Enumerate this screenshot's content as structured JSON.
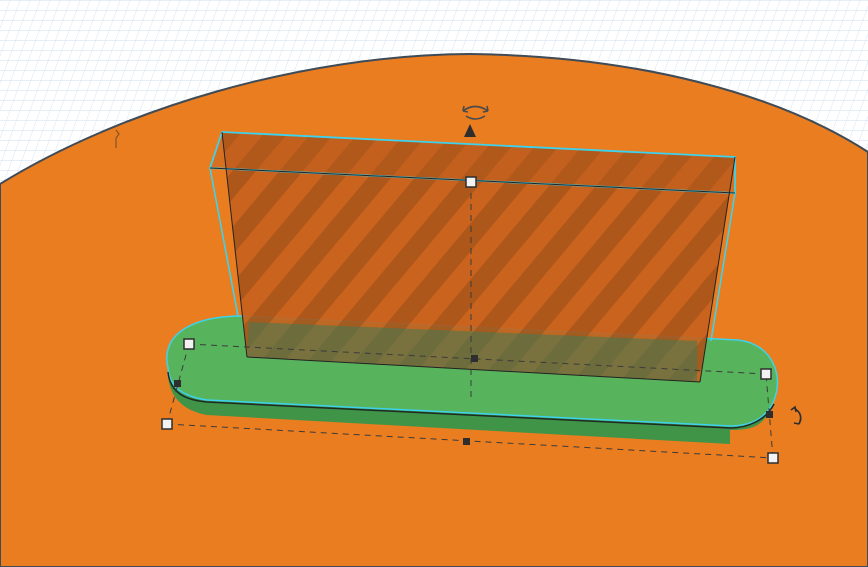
{
  "app": {
    "view": "3d-workplane",
    "selection": [
      "hole-box",
      "rounded-slot-base"
    ]
  },
  "colors": {
    "grid_background": "#ffffff",
    "grid_line": "#c9dcee",
    "workplane": "#e97d20",
    "workplane_edge": "#3f4b56",
    "hole_fill": "#c7611e",
    "hole_stripe": "#a9541a",
    "selection_outline": "#3ed2ec",
    "base_top": "#57b45c",
    "base_side": "#3f9447",
    "handle_white": "#f2f2f2",
    "handle_dark": "#2e2e2e"
  },
  "objects": [
    {
      "name": "hole-box",
      "kind": "hole",
      "icon": "striped-hole"
    },
    {
      "name": "rounded-slot-base",
      "kind": "solid",
      "icon": "green-solid"
    }
  ],
  "tools": {
    "rotate_top_icon": "rotate-arrows-icon",
    "lift_cone_icon": "cone-lift-icon",
    "rotate_side_icon": "rotate-arrows-icon"
  }
}
